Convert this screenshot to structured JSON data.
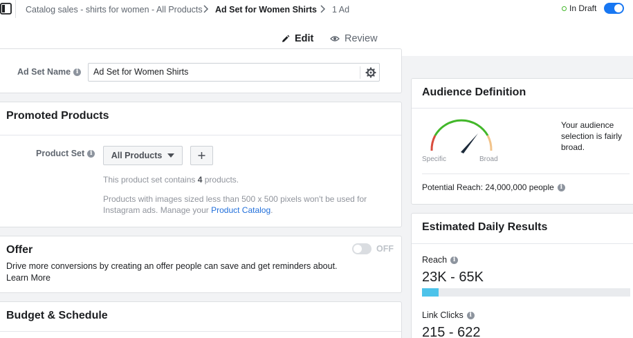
{
  "header": {
    "breadcrumb": [
      "Catalog sales - shirts for women - All Products",
      "Ad Set for Women Shirts",
      "1 Ad"
    ],
    "status": "In Draft",
    "status_toggle_on": true
  },
  "tabs": [
    {
      "label": "Edit",
      "active": true
    },
    {
      "label": "Review",
      "active": false
    }
  ],
  "ad_set": {
    "name_label": "Ad Set Name",
    "name_value": "Ad Set for Women Shirts"
  },
  "promoted_products": {
    "title": "Promoted Products",
    "product_set_label": "Product Set",
    "product_set_value": "All Products",
    "contains_prefix": "This product set contains ",
    "contains_count": "4",
    "contains_suffix": " products.",
    "image_note_line1": "Products with images sized less than 500 x 500 pixels won't be used for",
    "image_note_line2_prefix": "Instagram ads. Manage your ",
    "image_note_link": "Product Catalog",
    "image_note_line2_suffix": "."
  },
  "offer": {
    "title": "Offer",
    "toggle_label": "OFF",
    "toggle_on": false,
    "description": "Drive more conversions by creating an offer people can save and get reminders about.",
    "learn_more": "Learn More"
  },
  "budget": {
    "title": "Budget & Schedule"
  },
  "audience_definition": {
    "title": "Audience Definition",
    "gauge_left_label": "Specific",
    "gauge_right_label": "Broad",
    "description_line1": "Your audience",
    "description_line2": "selection is fairly",
    "description_line3": "broad.",
    "potential_reach": "Potential Reach: 24,000,000 people"
  },
  "estimated_daily_results": {
    "title": "Estimated Daily Results",
    "reach_label": "Reach",
    "reach_value": "23K - 65K",
    "reach_bar_fraction": 0.08,
    "link_clicks_label": "Link Clicks",
    "link_clicks_value": "215 - 622"
  },
  "colors": {
    "accent": "#1877f2",
    "reach_bar": "#4dc3ea",
    "gauge_green": "#42b72a",
    "gauge_red": "#d94c3d",
    "gauge_yellow": "#f2c38a"
  },
  "icons": [
    "sidebar-toggle-icon",
    "chevron-right-icon",
    "pencil-icon",
    "eye-icon",
    "info-icon",
    "gear-icon",
    "plus-icon",
    "caret-down-icon",
    "gauge-icon"
  ]
}
